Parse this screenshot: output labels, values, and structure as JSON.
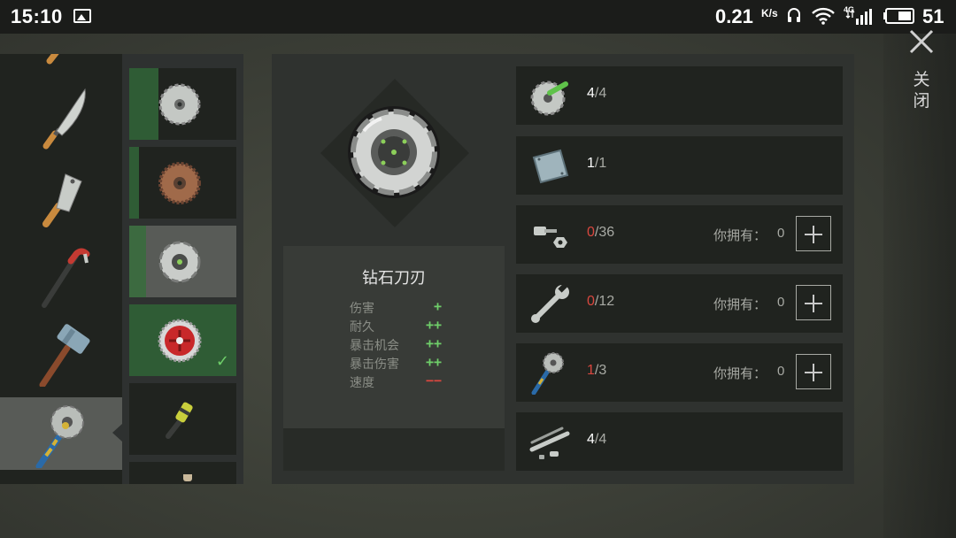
{
  "status_bar": {
    "time": "15:10",
    "net_speed": "0.21",
    "net_unit": "K/s",
    "network_type": "4G",
    "battery": "51"
  },
  "close": {
    "label": "关闭"
  },
  "weapons": [
    "knife",
    "machete",
    "cleaver",
    "crowbar",
    "hammer",
    "saw-blade-mace"
  ],
  "blades": [
    {
      "name": "saw-blade",
      "progress": 0.27
    },
    {
      "name": "rusty-saw-blade",
      "progress": 0.09
    },
    {
      "name": "diamond-saw-blade",
      "progress": 0.16
    },
    {
      "name": "red-saw-blade",
      "progress": 1.0
    },
    {
      "name": "yellow-grip",
      "progress": 0
    },
    {
      "name": "next-item",
      "progress": 0
    }
  ],
  "item": {
    "name": "钻石刀刃",
    "stats": [
      {
        "label": "伤害",
        "value": "+",
        "kind": "good"
      },
      {
        "label": "耐久",
        "value": "++",
        "kind": "good"
      },
      {
        "label": "暴击机会",
        "value": "++",
        "kind": "good"
      },
      {
        "label": "暴击伤害",
        "value": "++",
        "kind": "good"
      },
      {
        "label": "速度",
        "value": "−−",
        "kind": "bad"
      }
    ]
  },
  "materials": [
    {
      "icon": "saw-blade-icon",
      "have": "4",
      "need": "4",
      "lacking": false,
      "show_owned": false
    },
    {
      "icon": "metal-plate-icon",
      "have": "1",
      "need": "1",
      "lacking": false,
      "show_owned": false
    },
    {
      "icon": "bolt-nut-icon",
      "have": "0",
      "need": "36",
      "lacking": true,
      "show_owned": true,
      "owned_label": "你拥有：",
      "owned": "0"
    },
    {
      "icon": "wrench-icon",
      "have": "0",
      "need": "12",
      "lacking": true,
      "show_owned": true,
      "owned_label": "你拥有：",
      "owned": "0"
    },
    {
      "icon": "saw-mace-icon",
      "have": "1",
      "need": "3",
      "lacking": true,
      "show_owned": true,
      "owned_label": "你拥有：",
      "owned": "0"
    },
    {
      "icon": "pipe-parts-icon",
      "have": "4",
      "need": "4",
      "lacking": false,
      "show_owned": false
    }
  ],
  "colors": {
    "good": "#6fcf6a",
    "bad": "#d9473f",
    "progress_green": "#2f5c35"
  }
}
